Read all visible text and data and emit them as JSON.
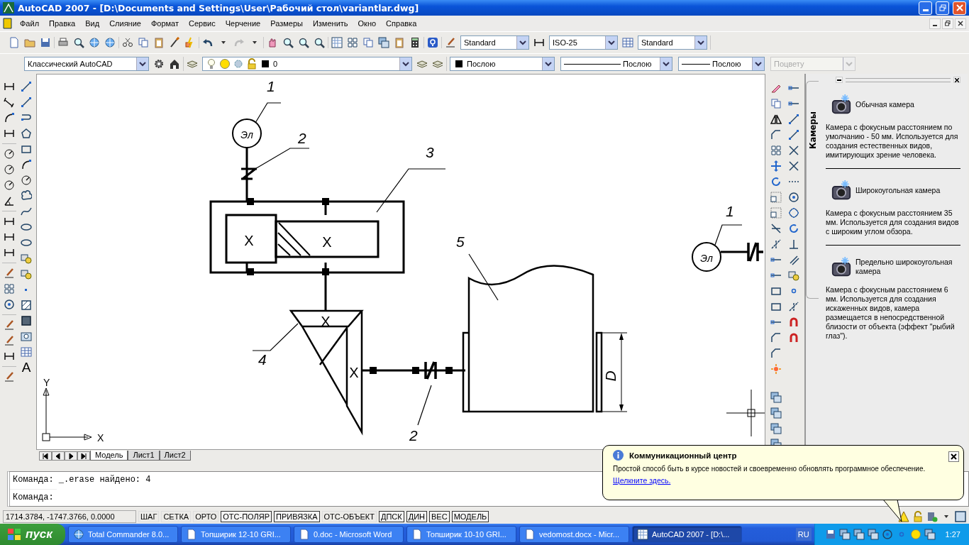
{
  "window": {
    "title": "AutoCAD 2007 - [D:\\Documents and Settings\\User\\Рабочий стол\\variantlar.dwg]"
  },
  "menu": [
    "Файл",
    "Правка",
    "Вид",
    "Слияние",
    "Формат",
    "Сервис",
    "Черчение",
    "Размеры",
    "Изменить",
    "Окно",
    "Справка"
  ],
  "styles_toolbar": {
    "text_style": "Standard",
    "dim_style": "ISO-25",
    "table_style": "Standard"
  },
  "properties_toolbar": {
    "workspace": "Классический AutoCAD",
    "layer": "0",
    "color_dropdown": "Послою",
    "linetype": "Послою",
    "lineweight": "Послою",
    "plot_style": {
      "value": "Поцвету",
      "disabled": true
    }
  },
  "draw_toolbar": {
    "text_tool": "A"
  },
  "drawing": {
    "callouts": [
      "1",
      "2",
      "3",
      "4",
      "5",
      "2",
      "1"
    ],
    "motor_labels": [
      "Эл",
      "Эл"
    ],
    "gear_marks": [
      "X",
      "X",
      "X",
      "X"
    ],
    "dimension": "D",
    "ucs": {
      "y_axis": "Y",
      "x_axis": "X"
    }
  },
  "layout_tabs": [
    {
      "label": "Модель",
      "selected": true
    },
    {
      "label": "Лист1",
      "selected": false
    },
    {
      "label": "Лист2",
      "selected": false
    }
  ],
  "command_lines": [
    "Команда: _.erase найдено: 4",
    "Команда:"
  ],
  "status_bar": {
    "coordinates": "1714.3784, -1747.3766, 0.0000",
    "toggles": [
      {
        "label": "ШАГ",
        "on": false
      },
      {
        "label": "СЕТКА",
        "on": false
      },
      {
        "label": "ОРТО",
        "on": false
      },
      {
        "label": "ОТС-ПОЛЯР",
        "on": true
      },
      {
        "label": "ПРИВЯЗКА",
        "on": true
      },
      {
        "label": "ОТС-ОБЪЕКТ",
        "on": false
      },
      {
        "label": "ДПСК",
        "on": true
      },
      {
        "label": "ДИН",
        "on": true
      },
      {
        "label": "ВЕС",
        "on": true
      },
      {
        "label": "МОДЕЛЬ",
        "on": true
      }
    ]
  },
  "palette": {
    "tab": "Камеры",
    "items": [
      {
        "name": "Обычная камера",
        "description": "Камера с фокусным расстоянием по умолчанию - 50 мм. Используется для создания естественных видов, имитирующих зрение человека."
      },
      {
        "name": "Широкоугольная камера",
        "description": "Камера с фокусным расстоянием 35 мм. Используется для создания видов с широким углом обзора."
      },
      {
        "name": "Предельно широкоугольная камера",
        "description": "Камера с фокусным расстоянием 6 мм. Используется для создания искаженных видов, камера размещается в непосредственной близости от объекта (эффект \"рыбий глаз\")."
      }
    ]
  },
  "balloon": {
    "title": "Коммуникационный центр",
    "text": "Простой способ быть в курсе новостей и своевременно обновлять программное обеспечение.",
    "link": "Щелкните здесь."
  },
  "taskbar": {
    "start": "пуск",
    "windows": [
      {
        "label": "Total Commander 8.0...",
        "kind": "commander",
        "selected": false
      },
      {
        "label": "Топширик 12-10 GRI...",
        "kind": "word",
        "selected": false
      },
      {
        "label": "0.doc - Microsoft Word",
        "kind": "word",
        "selected": false
      },
      {
        "label": "Топширик 10-10 GRI...",
        "kind": "word",
        "selected": false
      },
      {
        "label": "vedomost.docx - Micr...",
        "kind": "word",
        "selected": false
      },
      {
        "label": "AutoCAD 2007 - [D:\\...",
        "kind": "autocad",
        "selected": true
      }
    ],
    "language": "RU",
    "clock": "1:27"
  }
}
